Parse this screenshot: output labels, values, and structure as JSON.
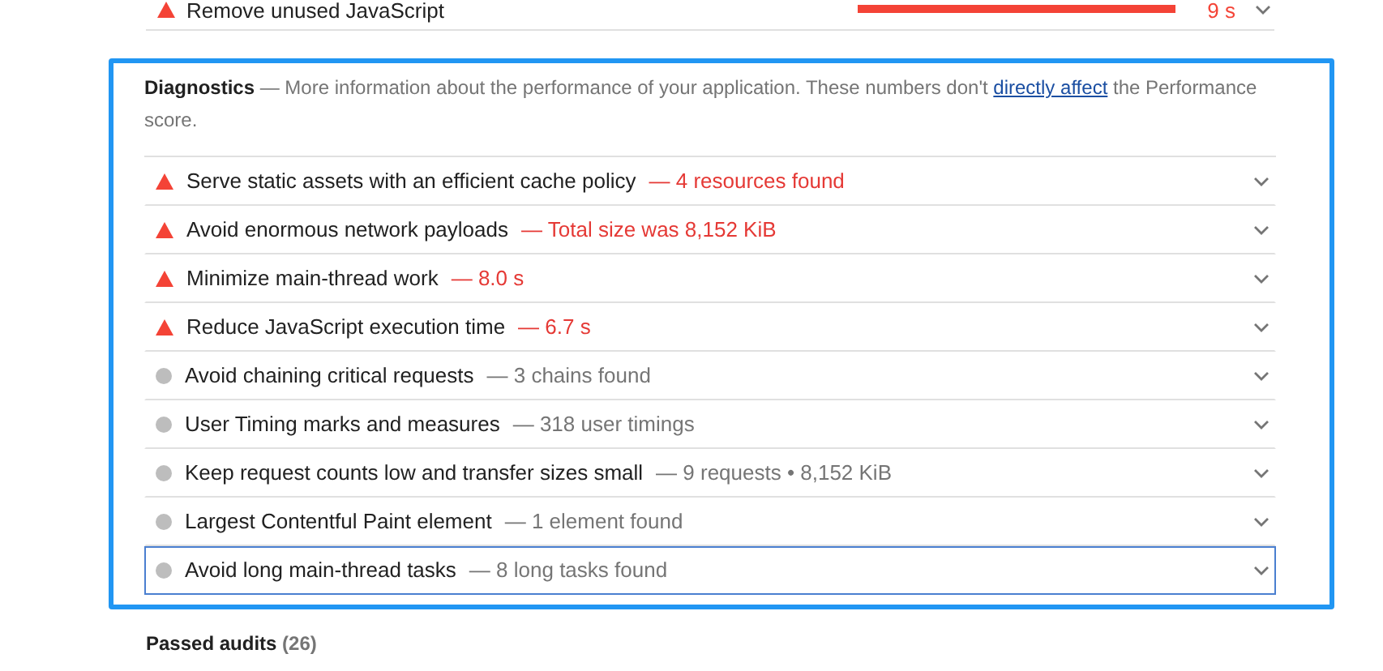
{
  "opportunity": {
    "kind": "fail",
    "title": "Remove unused JavaScript",
    "value": "9 s"
  },
  "diagnostics": {
    "title": "Diagnostics",
    "text_before": "— More information about the performance of your application. These numbers don't",
    "link": "directly affect",
    "text_after": "the Performance score.",
    "items": [
      {
        "kind": "fail",
        "title": "Serve static assets with an efficient cache policy",
        "detail": "— 4 resources found",
        "selected": false
      },
      {
        "kind": "fail",
        "title": "Avoid enormous network payloads",
        "detail": "— Total size was 8,152 KiB",
        "selected": false
      },
      {
        "kind": "fail",
        "title": "Minimize main-thread work",
        "detail": "— 8.0 s",
        "selected": false
      },
      {
        "kind": "fail",
        "title": "Reduce JavaScript execution time",
        "detail": "— 6.7 s",
        "selected": false
      },
      {
        "kind": "info",
        "title": "Avoid chaining critical requests",
        "detail": "— 3 chains found",
        "selected": false
      },
      {
        "kind": "info",
        "title": "User Timing marks and measures",
        "detail": "— 318 user timings",
        "selected": false
      },
      {
        "kind": "info",
        "title": "Keep request counts low and transfer sizes small",
        "detail": "— 9 requests • 8,152 KiB",
        "selected": false
      },
      {
        "kind": "info",
        "title": "Largest Contentful Paint element",
        "detail": "— 1 element found",
        "selected": false
      },
      {
        "kind": "info",
        "title": "Avoid long main-thread tasks",
        "detail": "— 8 long tasks found",
        "selected": true
      }
    ]
  },
  "passed": {
    "title": "Passed audits",
    "count": "(26)"
  }
}
